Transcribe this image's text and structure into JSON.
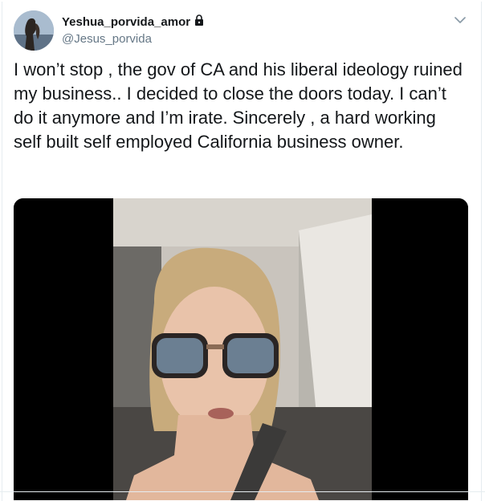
{
  "tweet": {
    "author": {
      "display_name": "Yeshua_porvida_amor",
      "handle": "@Jesus_porvida",
      "protected": true
    },
    "text": "I won’t stop , the gov of CA  and his liberal ideology ruined my business.. I decided to close the doors today. I can’t do it anymore and I’m irate. Sincerely , a hard working self built self employed California business owner.",
    "menu_icon": "chevron-down-icon",
    "lock_icon": "lock-icon",
    "media": {
      "type": "video"
    }
  },
  "colors": {
    "text": "#14171a",
    "secondary": "#657786",
    "border": "#e6ecf0"
  }
}
